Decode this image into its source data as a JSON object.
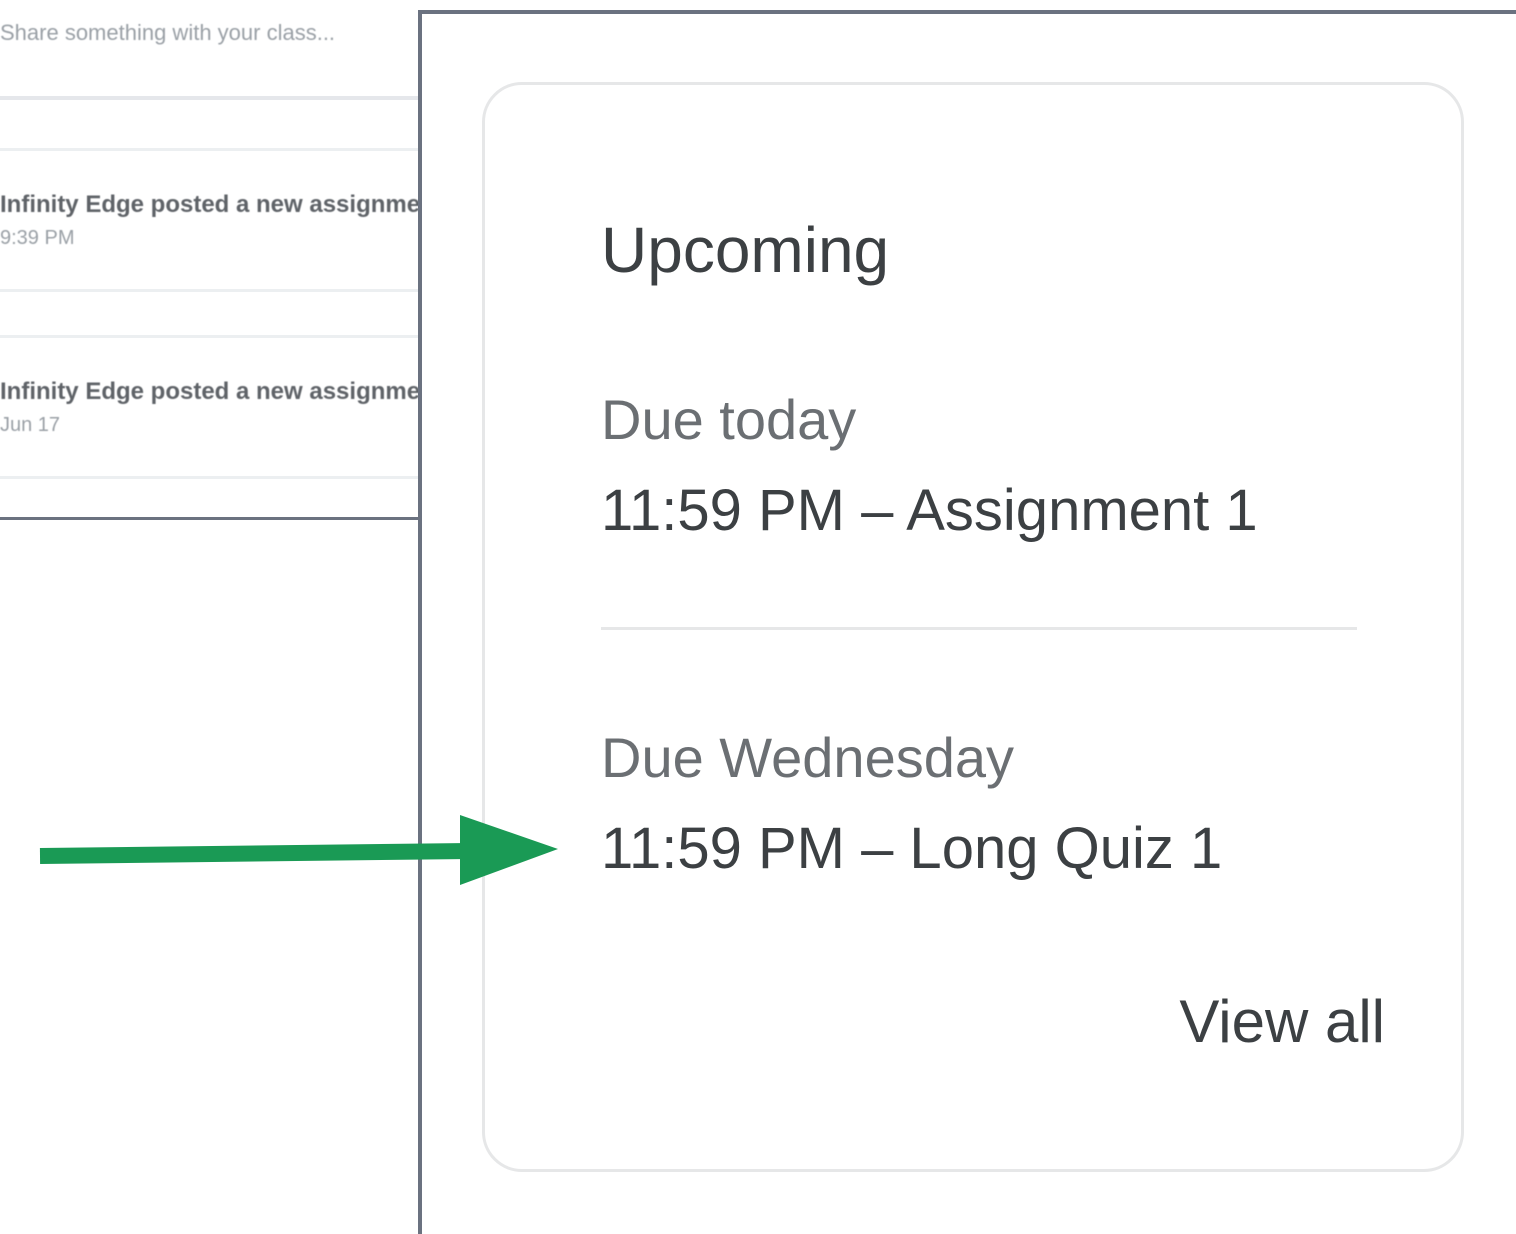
{
  "stream": {
    "share_placeholder": "Share something with your class...",
    "items": [
      {
        "title": "Infinity Edge posted a new assignment",
        "meta": "9:39 PM"
      },
      {
        "title": "Infinity Edge posted a new assignment",
        "meta": "Jun 17"
      }
    ]
  },
  "upcoming": {
    "title": "Upcoming",
    "groups": [
      {
        "label": "Due today",
        "item": "11:59 PM – Assignment 1"
      },
      {
        "label": "Due Wednesday",
        "item": "11:59 PM – Long Quiz 1"
      }
    ],
    "view_all_label": "View all"
  },
  "colors": {
    "arrow": "#1a9a55",
    "frame_border": "#6b7280",
    "card_border": "#e6e7e8",
    "text_primary": "#3c4043",
    "text_secondary": "#6b6f73"
  },
  "icons": {
    "annotation": "arrow-right-icon"
  }
}
